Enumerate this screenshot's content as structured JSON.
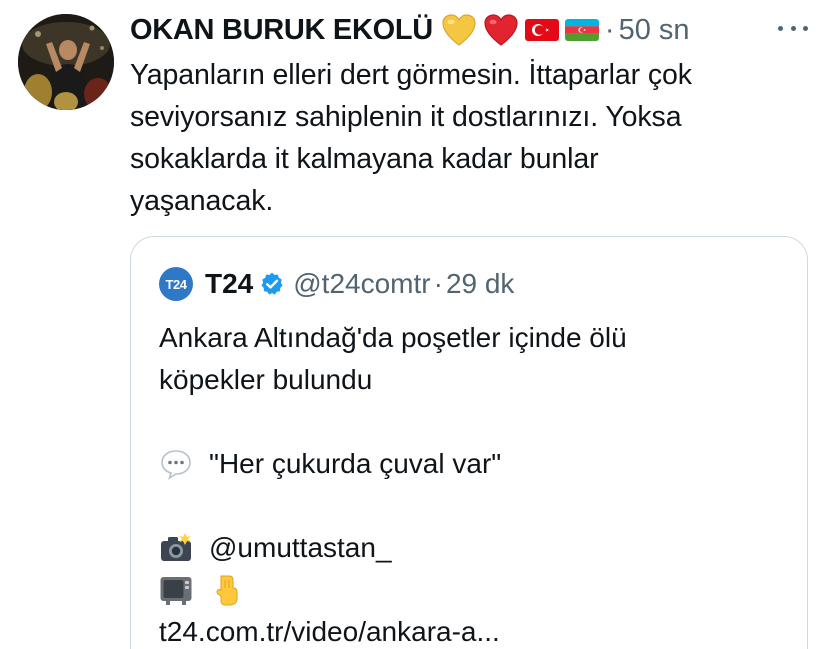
{
  "tweet": {
    "display_name": "OKAN BURUK EKOLÜ",
    "badges": [
      "yellow-heart-icon",
      "red-heart-icon",
      "turkey-flag-icon",
      "azerbaijan-flag-icon"
    ],
    "separator": "·",
    "timestamp": "50 sn",
    "text": "Yapanların elleri dert görmesin. İttaparlar çok\nseviyorsanız sahiplenin it dostlarınızı. Yoksa\nsokaklarda it kalmayana kadar bunlar\nyaşanacak."
  },
  "quote": {
    "avatar_text": "T24",
    "name": "T24",
    "handle": "@t24comtr",
    "separator": "·",
    "timestamp": "29 dk",
    "headline": "Ankara Altındağ'da poşetler içinde ölü\nköpekler bulundu",
    "quote_line": "\"Her çukurda çuval var\"",
    "credit_line": "@umuttastan_",
    "link": "t24.com.tr/video/ankara-a..."
  },
  "colors": {
    "text": "#0f1419",
    "muted": "#536471",
    "border": "#cfd9de",
    "verified": "#1d9bf0",
    "t24_brand": "#2f77c7"
  }
}
